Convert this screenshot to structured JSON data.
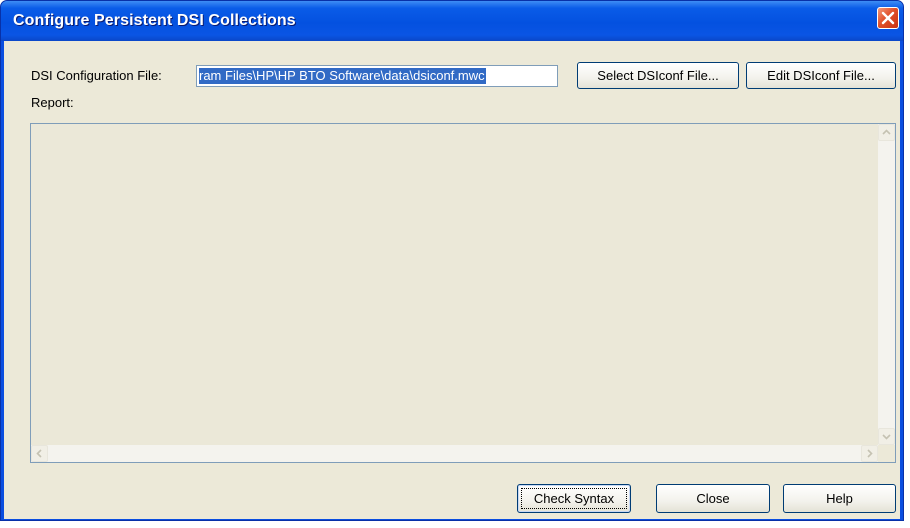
{
  "window": {
    "title": "Configure Persistent DSI Collections"
  },
  "config": {
    "label": "DSI Configuration File:",
    "path_value": "ram Files\\HP\\HP BTO Software\\data\\dsiconf.mwc"
  },
  "buttons": {
    "select_file": "Select DSIconf File...",
    "edit_file": "Edit DSIconf File...",
    "check_syntax": "Check Syntax",
    "close": "Close",
    "help": "Help"
  },
  "report": {
    "label": "Report:"
  },
  "icons": {
    "close": "close-x-icon",
    "scroll_up": "arrow-up-icon",
    "scroll_down": "arrow-down-icon",
    "scroll_left": "arrow-left-icon",
    "scroll_right": "arrow-right-icon"
  },
  "colors": {
    "titlebar": "#0451e0",
    "dialog_face": "#ece9d8",
    "selection": "#316ac5",
    "close_button": "#e0502a"
  }
}
